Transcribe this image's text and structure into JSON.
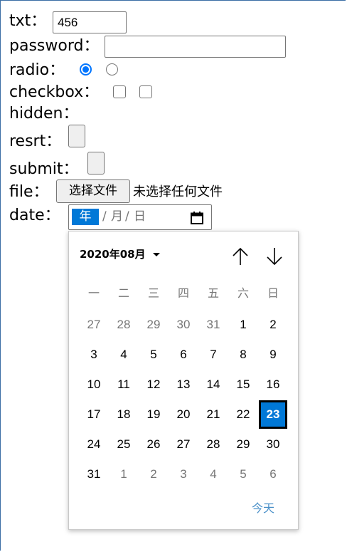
{
  "form": {
    "txt_label": "txt：",
    "txt_value": "456",
    "password_label": "password：",
    "radio_label": "radio：",
    "checkbox_label": "checkbox：",
    "hidden_label": "hidden：",
    "reset_label": "resrt：",
    "submit_label": "submit：",
    "file_label": "file：",
    "file_button": "选择文件",
    "file_status": "未选择任何文件",
    "date_label": "date：",
    "date_year_segment": "年",
    "date_month_segment": "月",
    "date_day_segment": "日",
    "date_separator": "/",
    "radio_checked": [
      true,
      false
    ],
    "checkbox_checked": [
      false,
      false
    ]
  },
  "datepicker": {
    "month_label": "2020年08月",
    "weekdays": [
      "一",
      "二",
      "三",
      "四",
      "五",
      "六",
      "日"
    ],
    "weeks": [
      [
        "27",
        "28",
        "29",
        "30",
        "31",
        "1",
        "2"
      ],
      [
        "3",
        "4",
        "5",
        "6",
        "7",
        "8",
        "9"
      ],
      [
        "10",
        "11",
        "12",
        "13",
        "14",
        "15",
        "16"
      ],
      [
        "17",
        "18",
        "19",
        "20",
        "21",
        "22",
        "23"
      ],
      [
        "24",
        "25",
        "26",
        "27",
        "28",
        "29",
        "30"
      ],
      [
        "31",
        "1",
        "2",
        "3",
        "4",
        "5",
        "6"
      ]
    ],
    "selected_day": "23",
    "today_label": "今天",
    "accent_color": "#0078d7"
  }
}
